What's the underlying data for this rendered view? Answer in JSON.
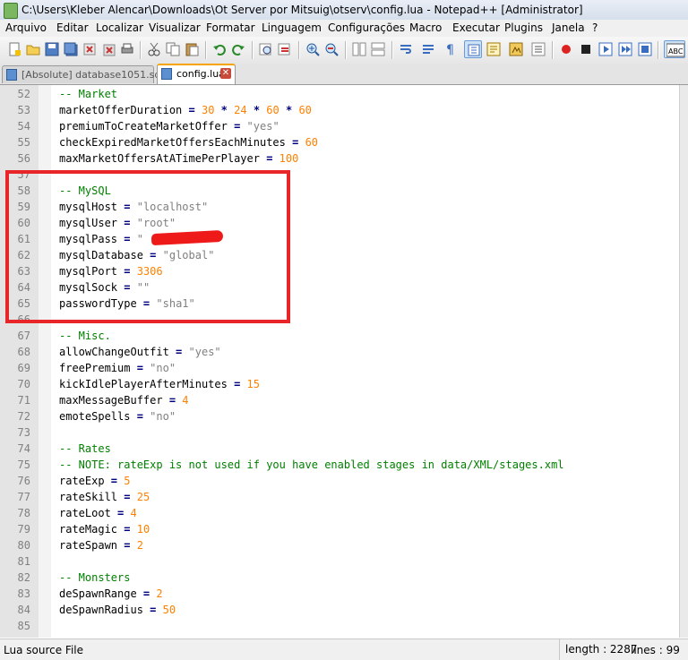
{
  "window": {
    "title": "C:\\Users\\Kleber Alencar\\Downloads\\Ot Server por Mitsuig\\otserv\\config.lua - Notepad++ [Administrator]"
  },
  "menu": [
    "Arquivo",
    "Editar",
    "Localizar",
    "Visualizar",
    "Formatar",
    "Linguagem",
    "Configurações",
    "Macro",
    "Executar",
    "Plugins",
    "Janela",
    "?"
  ],
  "tabs": [
    {
      "label": "[Absolute] database1051.sql",
      "active": false
    },
    {
      "label": "config.lua",
      "active": true
    }
  ],
  "colors": {
    "comment": "#008000",
    "number": "#ff8000",
    "string": "#808080",
    "operator": "#000080",
    "highlight_box": "#e8262a"
  },
  "editor": {
    "lines": [
      {
        "n": "52",
        "tokens": [
          {
            "t": "-- Market",
            "c": "cmt"
          }
        ]
      },
      {
        "n": "53",
        "tokens": [
          {
            "t": "marketOfferDuration ",
            "c": "id"
          },
          {
            "t": "=",
            "c": "op"
          },
          {
            "t": " ",
            "c": "id"
          },
          {
            "t": "30",
            "c": "num"
          },
          {
            "t": " ",
            "c": "id"
          },
          {
            "t": "*",
            "c": "op"
          },
          {
            "t": " ",
            "c": "id"
          },
          {
            "t": "24",
            "c": "num"
          },
          {
            "t": " ",
            "c": "id"
          },
          {
            "t": "*",
            "c": "op"
          },
          {
            "t": " ",
            "c": "id"
          },
          {
            "t": "60",
            "c": "num"
          },
          {
            "t": " ",
            "c": "id"
          },
          {
            "t": "*",
            "c": "op"
          },
          {
            "t": " ",
            "c": "id"
          },
          {
            "t": "60",
            "c": "num"
          }
        ]
      },
      {
        "n": "54",
        "tokens": [
          {
            "t": "premiumToCreateMarketOffer ",
            "c": "id"
          },
          {
            "t": "=",
            "c": "op"
          },
          {
            "t": " ",
            "c": "id"
          },
          {
            "t": "\"yes\"",
            "c": "str"
          }
        ]
      },
      {
        "n": "55",
        "tokens": [
          {
            "t": "checkExpiredMarketOffersEachMinutes ",
            "c": "id"
          },
          {
            "t": "=",
            "c": "op"
          },
          {
            "t": " ",
            "c": "id"
          },
          {
            "t": "60",
            "c": "num"
          }
        ]
      },
      {
        "n": "56",
        "tokens": [
          {
            "t": "maxMarketOffersAtATimePerPlayer ",
            "c": "id"
          },
          {
            "t": "=",
            "c": "op"
          },
          {
            "t": " ",
            "c": "id"
          },
          {
            "t": "100",
            "c": "num"
          }
        ]
      },
      {
        "n": "57",
        "tokens": []
      },
      {
        "n": "58",
        "tokens": [
          {
            "t": "-- MySQL",
            "c": "cmt"
          }
        ]
      },
      {
        "n": "59",
        "tokens": [
          {
            "t": "mysqlHost ",
            "c": "id"
          },
          {
            "t": "=",
            "c": "op"
          },
          {
            "t": " ",
            "c": "id"
          },
          {
            "t": "\"localhost\"",
            "c": "str"
          }
        ]
      },
      {
        "n": "60",
        "tokens": [
          {
            "t": "mysqlUser ",
            "c": "id"
          },
          {
            "t": "=",
            "c": "op"
          },
          {
            "t": " ",
            "c": "id"
          },
          {
            "t": "\"root\"",
            "c": "str"
          }
        ]
      },
      {
        "n": "61",
        "tokens": [
          {
            "t": "mysqlPass ",
            "c": "id"
          },
          {
            "t": "=",
            "c": "op"
          },
          {
            "t": " ",
            "c": "id"
          },
          {
            "t": "\"",
            "c": "str"
          },
          {
            "t": "           ",
            "c": "id"
          },
          {
            "t": "\"",
            "c": "str"
          }
        ]
      },
      {
        "n": "62",
        "tokens": [
          {
            "t": "mysqlDatabase ",
            "c": "id"
          },
          {
            "t": "=",
            "c": "op"
          },
          {
            "t": " ",
            "c": "id"
          },
          {
            "t": "\"global\"",
            "c": "str"
          }
        ]
      },
      {
        "n": "63",
        "tokens": [
          {
            "t": "mysqlPort ",
            "c": "id"
          },
          {
            "t": "=",
            "c": "op"
          },
          {
            "t": " ",
            "c": "id"
          },
          {
            "t": "3306",
            "c": "num"
          }
        ]
      },
      {
        "n": "64",
        "tokens": [
          {
            "t": "mysqlSock ",
            "c": "id"
          },
          {
            "t": "=",
            "c": "op"
          },
          {
            "t": " ",
            "c": "id"
          },
          {
            "t": "\"\"",
            "c": "str"
          }
        ]
      },
      {
        "n": "65",
        "tokens": [
          {
            "t": "passwordType ",
            "c": "id"
          },
          {
            "t": "=",
            "c": "op"
          },
          {
            "t": " ",
            "c": "id"
          },
          {
            "t": "\"sha1\"",
            "c": "str"
          }
        ]
      },
      {
        "n": "66",
        "tokens": []
      },
      {
        "n": "67",
        "tokens": [
          {
            "t": "-- Misc.",
            "c": "cmt"
          }
        ]
      },
      {
        "n": "68",
        "tokens": [
          {
            "t": "allowChangeOutfit ",
            "c": "id"
          },
          {
            "t": "=",
            "c": "op"
          },
          {
            "t": " ",
            "c": "id"
          },
          {
            "t": "\"yes\"",
            "c": "str"
          }
        ]
      },
      {
        "n": "69",
        "tokens": [
          {
            "t": "freePremium ",
            "c": "id"
          },
          {
            "t": "=",
            "c": "op"
          },
          {
            "t": " ",
            "c": "id"
          },
          {
            "t": "\"no\"",
            "c": "str"
          }
        ]
      },
      {
        "n": "70",
        "tokens": [
          {
            "t": "kickIdlePlayerAfterMinutes ",
            "c": "id"
          },
          {
            "t": "=",
            "c": "op"
          },
          {
            "t": " ",
            "c": "id"
          },
          {
            "t": "15",
            "c": "num"
          }
        ]
      },
      {
        "n": "71",
        "tokens": [
          {
            "t": "maxMessageBuffer ",
            "c": "id"
          },
          {
            "t": "=",
            "c": "op"
          },
          {
            "t": " ",
            "c": "id"
          },
          {
            "t": "4",
            "c": "num"
          }
        ]
      },
      {
        "n": "72",
        "tokens": [
          {
            "t": "emoteSpells ",
            "c": "id"
          },
          {
            "t": "=",
            "c": "op"
          },
          {
            "t": " ",
            "c": "id"
          },
          {
            "t": "\"no\"",
            "c": "str"
          }
        ]
      },
      {
        "n": "73",
        "tokens": []
      },
      {
        "n": "74",
        "tokens": [
          {
            "t": "-- Rates",
            "c": "cmt"
          }
        ]
      },
      {
        "n": "75",
        "tokens": [
          {
            "t": "-- NOTE: rateExp is not used if you have enabled stages in data/XML/stages.xml",
            "c": "cmt"
          }
        ]
      },
      {
        "n": "76",
        "tokens": [
          {
            "t": "rateExp ",
            "c": "id"
          },
          {
            "t": "=",
            "c": "op"
          },
          {
            "t": " ",
            "c": "id"
          },
          {
            "t": "5",
            "c": "num"
          }
        ]
      },
      {
        "n": "77",
        "tokens": [
          {
            "t": "rateSkill ",
            "c": "id"
          },
          {
            "t": "=",
            "c": "op"
          },
          {
            "t": " ",
            "c": "id"
          },
          {
            "t": "25",
            "c": "num"
          }
        ]
      },
      {
        "n": "78",
        "tokens": [
          {
            "t": "rateLoot ",
            "c": "id"
          },
          {
            "t": "=",
            "c": "op"
          },
          {
            "t": " ",
            "c": "id"
          },
          {
            "t": "4",
            "c": "num"
          }
        ]
      },
      {
        "n": "79",
        "tokens": [
          {
            "t": "rateMagic ",
            "c": "id"
          },
          {
            "t": "=",
            "c": "op"
          },
          {
            "t": " ",
            "c": "id"
          },
          {
            "t": "10",
            "c": "num"
          }
        ]
      },
      {
        "n": "80",
        "tokens": [
          {
            "t": "rateSpawn ",
            "c": "id"
          },
          {
            "t": "=",
            "c": "op"
          },
          {
            "t": " ",
            "c": "id"
          },
          {
            "t": "2",
            "c": "num"
          }
        ]
      },
      {
        "n": "81",
        "tokens": []
      },
      {
        "n": "82",
        "tokens": [
          {
            "t": "-- Monsters",
            "c": "cmt"
          }
        ]
      },
      {
        "n": "83",
        "tokens": [
          {
            "t": "deSpawnRange ",
            "c": "id"
          },
          {
            "t": "=",
            "c": "op"
          },
          {
            "t": " ",
            "c": "id"
          },
          {
            "t": "2",
            "c": "num"
          }
        ]
      },
      {
        "n": "84",
        "tokens": [
          {
            "t": "deSpawnRadius ",
            "c": "id"
          },
          {
            "t": "=",
            "c": "op"
          },
          {
            "t": " ",
            "c": "id"
          },
          {
            "t": "50",
            "c": "num"
          }
        ]
      },
      {
        "n": "85",
        "tokens": []
      }
    ]
  },
  "status": {
    "file_type": "Lua source File",
    "length": "length : 2287",
    "lines": "lines : 99"
  }
}
